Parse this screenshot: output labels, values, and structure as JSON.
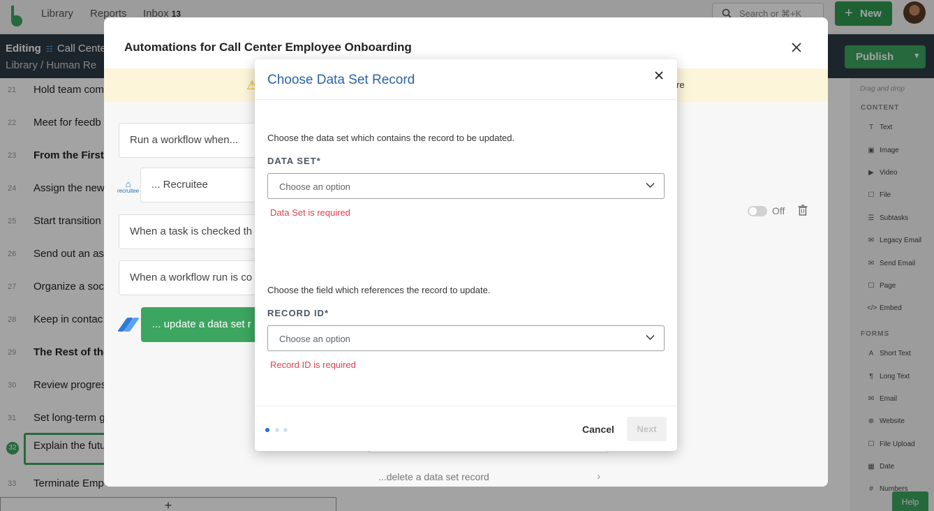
{
  "topnav": {
    "library": "Library",
    "reports": "Reports",
    "inbox": "Inbox",
    "inbox_count": "13",
    "search_placeholder": "Search or ⌘+K",
    "new_label": "New"
  },
  "editbar": {
    "editing_label": "Editing",
    "template_name": "Call Cente",
    "breadcrumb": "Library  /  Human Re",
    "publish_label": "Publish"
  },
  "tasks": [
    {
      "num": "21",
      "text": "Hold team com",
      "bold": false
    },
    {
      "num": "22",
      "text": "Meet for feedb",
      "bold": false
    },
    {
      "num": "23",
      "text": "From the First",
      "bold": true
    },
    {
      "num": "24",
      "text": "Assign the new",
      "bold": false
    },
    {
      "num": "25",
      "text": "Start transition",
      "bold": false
    },
    {
      "num": "26",
      "text": "Send out an as",
      "bold": false
    },
    {
      "num": "27",
      "text": "Organize a soc",
      "bold": false
    },
    {
      "num": "28",
      "text": "Keep in contac",
      "bold": false
    },
    {
      "num": "29",
      "text": "The Rest of the",
      "bold": true
    },
    {
      "num": "30",
      "text": "Review progres",
      "bold": false
    },
    {
      "num": "31",
      "text": "Set long-term g",
      "bold": false
    },
    {
      "num": "32",
      "text": "Explain the futu",
      "bold": false
    },
    {
      "num": "33",
      "text": "Terminate Emp",
      "bold": false
    }
  ],
  "add_task_label": "+",
  "widgets": {
    "hint": "Drag and drop",
    "content_head": "CONTENT",
    "content": [
      {
        "icon": "T",
        "label": "Text"
      },
      {
        "icon": "▣",
        "label": "Image"
      },
      {
        "icon": "▶",
        "label": "Video"
      },
      {
        "icon": "☐",
        "label": "File"
      },
      {
        "icon": "☰",
        "label": "Subtasks"
      },
      {
        "icon": "✉",
        "label": "Legacy Email"
      },
      {
        "icon": "✉",
        "label": "Send Email"
      },
      {
        "icon": "☐",
        "label": "Page"
      },
      {
        "icon": "</>",
        "label": "Embed"
      }
    ],
    "forms_head": "FORMS",
    "forms": [
      {
        "icon": "A",
        "label": "Short Text"
      },
      {
        "icon": "¶",
        "label": "Long Text"
      },
      {
        "icon": "✉",
        "label": "Email"
      },
      {
        "icon": "⊕",
        "label": "Website"
      },
      {
        "icon": "☐",
        "label": "File Upload"
      },
      {
        "icon": "▦",
        "label": "Date"
      },
      {
        "icon": "#",
        "label": "Numbers"
      }
    ]
  },
  "help_label": "Help",
  "automations": {
    "title": "Automations for Call Center Employee Onboarding",
    "warning_tail": "re",
    "cards": [
      {
        "text": "Run a workflow when..."
      },
      {
        "text": "... Recruitee"
      },
      {
        "text": "When a task is checked th"
      },
      {
        "text": "When a workflow run is co"
      },
      {
        "text": "... update a data set r"
      }
    ],
    "recruitee_logo": "recruitee",
    "toggle_label": "Off",
    "next_action": "...delete a data set record"
  },
  "record_modal": {
    "title": "Choose Data Set Record",
    "dataset_desc": "Choose the data set which contains the record to be updated.",
    "dataset_label": "DATA SET*",
    "dataset_placeholder": "Choose an option",
    "dataset_error": "Data Set is required",
    "record_desc": "Choose the field which references the record to update.",
    "record_label": "RECORD ID*",
    "record_placeholder": "Choose an option",
    "record_error": "Record ID is required",
    "cancel_label": "Cancel",
    "next_label": "Next",
    "steps_total": 3,
    "current_step": 1
  },
  "colors": {
    "brand_green": "#3ca560",
    "link_blue": "#2a64a8",
    "error_red": "#e0424f",
    "editbar_dark": "#2e3b45"
  }
}
